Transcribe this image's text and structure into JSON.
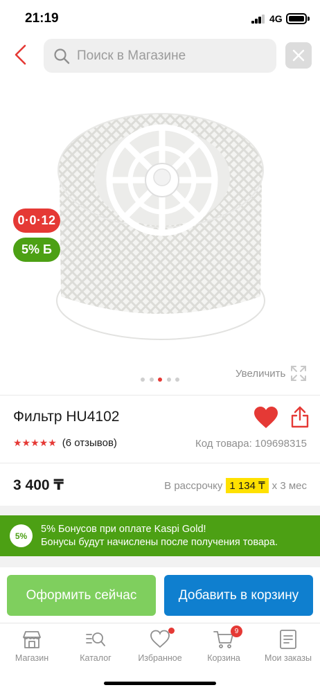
{
  "status_bar": {
    "time": "21:19",
    "network": "4G"
  },
  "header": {
    "search_placeholder": "Поиск в Магазине"
  },
  "gallery": {
    "badge_timer": "0·0·12",
    "badge_bonus": "5% Б",
    "zoom_label": "Увеличить",
    "dots_total": 5,
    "dots_active_index": 2
  },
  "product": {
    "title": "Фильтр HU4102",
    "stars": "★★★★★",
    "rating": 5,
    "reviews": "(6 отзывов)",
    "code": "Код товара: 109698315",
    "price": "3 400 ₸",
    "installment_prefix": "В рассрочку",
    "installment_amount": "1 134 ₸",
    "installment_suffix": "х 3 мес"
  },
  "bonus_banner": {
    "badge": "5%",
    "line1": "5% Бонусов при оплате Kaspi Gold!",
    "line2": "Бонусы будут начислены после получения товара."
  },
  "actions": {
    "checkout_label": "Оформить сейчас",
    "add_to_cart_label": "Добавить в корзину"
  },
  "bottom_nav": {
    "items": [
      {
        "label": "Магазин",
        "icon": "shop-icon"
      },
      {
        "label": "Каталог",
        "icon": "catalog-icon"
      },
      {
        "label": "Избранное",
        "icon": "heart-icon"
      },
      {
        "label": "Корзина",
        "icon": "cart-icon",
        "count": "9"
      },
      {
        "label": "Мои заказы",
        "icon": "orders-icon"
      }
    ]
  },
  "colors": {
    "accent_red": "#e53935",
    "bonus_green": "#4ca014",
    "checkout_green": "#7fcf5e",
    "cart_blue": "#0f7fcf",
    "installment_yellow": "#ffe100"
  }
}
